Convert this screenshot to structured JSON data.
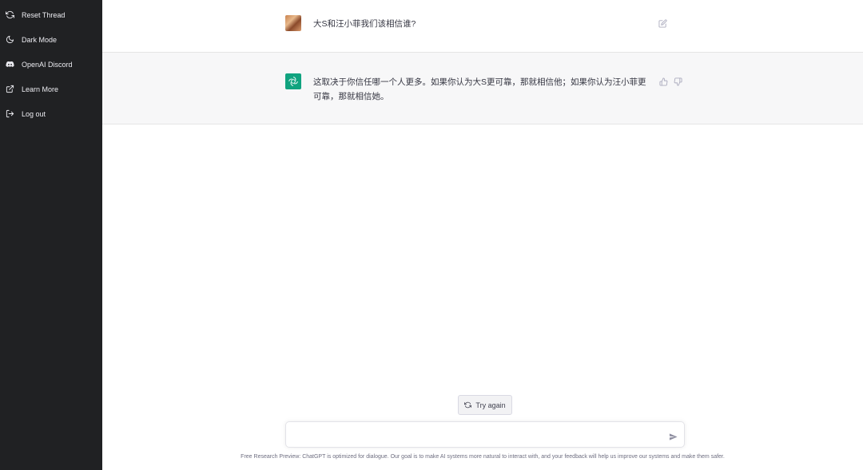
{
  "sidebar": {
    "items": [
      {
        "label": "Reset Thread",
        "icon": "refresh-icon"
      },
      {
        "label": "Dark Mode",
        "icon": "moon-icon"
      },
      {
        "label": "OpenAI Discord",
        "icon": "discord-icon"
      },
      {
        "label": "Learn More",
        "icon": "external-link-icon"
      },
      {
        "label": "Log out",
        "icon": "logout-icon"
      }
    ]
  },
  "conversation": {
    "user_message": "大S和汪小菲我们该相信谁?",
    "bot_message": "这取决于你信任哪一个人更多。如果你认为大S更可靠，那就相信他；如果你认为汪小菲更可靠，那就相信她。"
  },
  "actions": {
    "try_again_label": "Try again"
  },
  "input": {
    "value": "",
    "placeholder": ""
  },
  "footer": {
    "note": "Free Research Preview: ChatGPT is optimized for dialogue. Our goal is to make AI systems more natural to interact with, and your feedback will help us improve our systems and make them safer."
  },
  "colors": {
    "sidebar_bg": "#202123",
    "bot_row_bg": "#f7f7f8",
    "accent": "#10a37f"
  }
}
